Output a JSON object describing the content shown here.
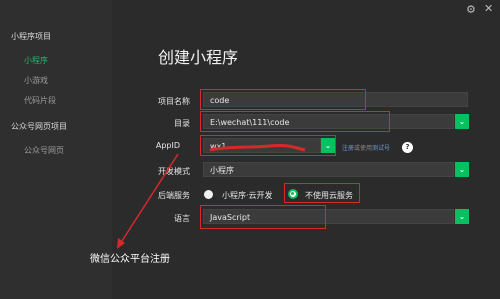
{
  "sidebar": {
    "group1": "小程序项目",
    "items1": [
      "小程序",
      "小游戏",
      "代码片段"
    ],
    "group2": "公众号网页项目",
    "items2": [
      "公众号网页"
    ]
  },
  "window": {
    "settings_icon": "gear-icon",
    "close_icon": "close-icon"
  },
  "page_title": "创建小程序",
  "form": {
    "name_label": "项目名称",
    "name_value": "code",
    "dir_label": "目录",
    "dir_value": "E:\\wechat\\111\\code",
    "appid_label": "AppID",
    "appid_value": "wx1...",
    "register_link": "注册",
    "or_use": "或使用",
    "test_link": "测试号",
    "help_icon": "question-icon",
    "devmode_label": "开发模式",
    "devmode_value": "小程序",
    "backend_label": "后端服务",
    "backend_opt1": "小程序·云开发",
    "backend_opt2": "不使用云服务",
    "backend_selected": "不使用云服务",
    "lang_label": "语言",
    "lang_value": "JavaScript"
  },
  "annotation": "微信公众平台注册",
  "colors": {
    "accent": "#07c160",
    "highlight_box": "#d42a2a",
    "arrow": "#d42a2a"
  }
}
